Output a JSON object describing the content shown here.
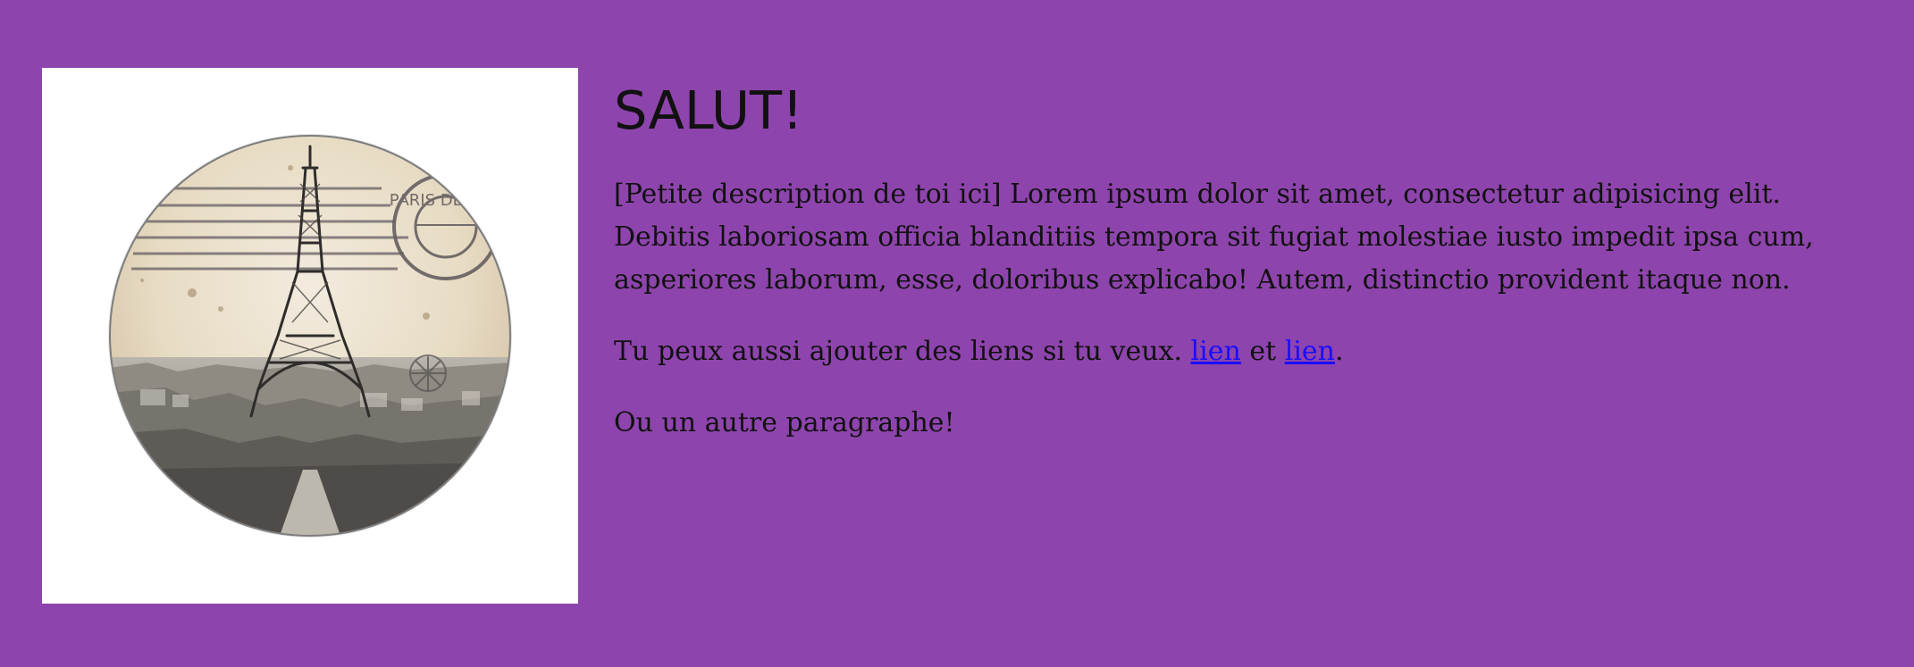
{
  "heading": {
    "title": "SALUT!"
  },
  "profile_image": {
    "icon": "eiffel-tower-postcard-icon",
    "stamp_text": "PARIS DEPART"
  },
  "content": {
    "description": "[Petite description de toi ici] Lorem ipsum dolor sit amet, consectetur adipisicing elit. Debitis laboriosam officia blanditiis tempora sit fugiat molestiae iusto impedit ipsa cum, asperiores laborum, esse, doloribus explicabo! Autem, distinctio provident itaque non.",
    "links_prefix": "Tu peux aussi ajouter des liens si tu veux.",
    "link1_label": "lien",
    "link_separator": "et",
    "link2_label": "lien",
    "link_suffix": ".",
    "other_paragraph": "Ou un autre paragraphe!"
  },
  "colors": {
    "background": "#8e44ad",
    "link": "#1a0dff",
    "text": "#111111",
    "card": "#ffffff"
  }
}
